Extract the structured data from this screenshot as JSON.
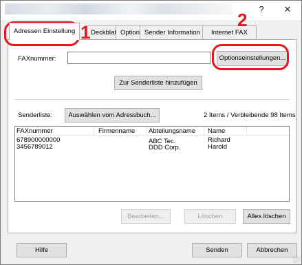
{
  "window": {
    "help_glyph": "?",
    "close_glyph": "✕"
  },
  "tabs": [
    {
      "label": "Adressen Einstellung"
    },
    {
      "label": "Deckblatt"
    },
    {
      "label": "Option"
    },
    {
      "label": "Sender Information"
    },
    {
      "label": "Internet FAX"
    }
  ],
  "fax": {
    "label": "FAXnummer:",
    "value": "",
    "options_button": "Optionseinstellungen...",
    "add_button": "Zur Senderliste hinzufügen"
  },
  "senderlist": {
    "label": "Senderliste:",
    "addressbook_button": "Auswählen vom Adressbuch...",
    "status": "2 Items / Verbleibende   98 Items",
    "columns": [
      "FAXnummer",
      "Firmenname",
      "Abteilungsname",
      "Name"
    ],
    "rows": [
      {
        "fax": "678900000000",
        "company": "",
        "department": "ABC Tec.",
        "name": "Richard"
      },
      {
        "fax": "3456789012",
        "company": "",
        "department": "DDD Corp.",
        "name": "Harold"
      }
    ]
  },
  "list_buttons": {
    "edit": "Bearbeiten...",
    "delete": "Löschen",
    "delete_all": "Alles löschen"
  },
  "footer": {
    "help": "Hilfe",
    "send": "Senden",
    "cancel": "Abbrechen"
  },
  "callouts": {
    "one": "1",
    "two": "2",
    "color": "#e8151e"
  }
}
